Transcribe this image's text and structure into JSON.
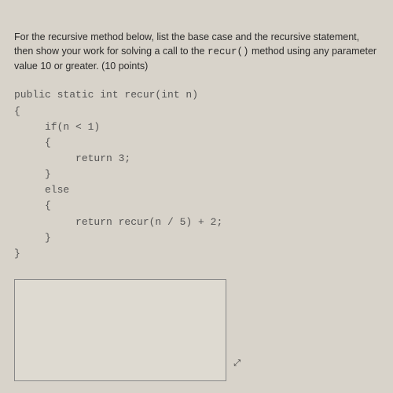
{
  "question": {
    "text_before_code": "For the recursive method below, list the base case and the recursive statement, then show your work for solving a call to the ",
    "inline_code": "recur()",
    "text_after_code": " method using any parameter value 10 or greater. (10 points)"
  },
  "code": "public static int recur(int n)\n{\n     if(n < 1)\n     {\n          return 3;\n     }\n     else\n     {\n          return recur(n / 5) + 2;\n     }\n}",
  "answer": {
    "value": "",
    "placeholder": ""
  },
  "resize_glyph": "⤢"
}
